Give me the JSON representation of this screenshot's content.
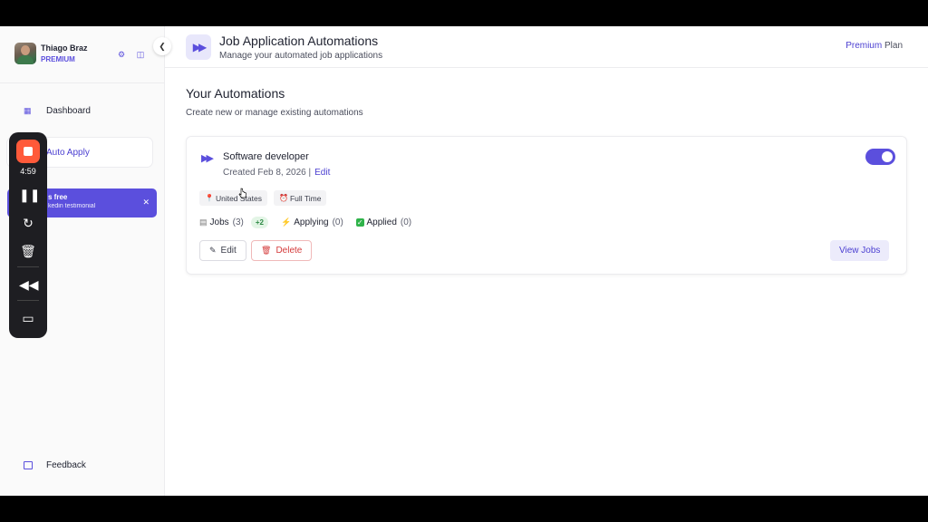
{
  "user": {
    "name": "Thiago Braz",
    "plan": "PREMIUM"
  },
  "sidebar": {
    "items": [
      {
        "label": "Dashboard",
        "icon": "grid-icon"
      },
      {
        "label": "Auto Apply",
        "icon": "fast-forward-icon"
      }
    ],
    "promo": {
      "title": "s free",
      "subtitle": "kedin testimonial"
    },
    "feedback_label": "Feedback"
  },
  "recorder": {
    "time": "4:59"
  },
  "header": {
    "title": "Job Application Automations",
    "subtitle": "Manage your automated job applications",
    "plan_name": "Premium",
    "plan_suffix": "Plan"
  },
  "main": {
    "title": "Your Automations",
    "subtitle": "Create new or manage existing automations"
  },
  "automation": {
    "title": "Software developer",
    "created": "Created Feb 8, 2026 |",
    "edit_link": "Edit",
    "enabled": true,
    "tags": [
      {
        "label": "United States",
        "icon": "pin-icon"
      },
      {
        "label": "Full Time",
        "icon": "alarm-icon"
      }
    ],
    "stats": {
      "jobs_label": "Jobs",
      "jobs_count": "(3)",
      "jobs_extra": "+2",
      "applying_label": "Applying",
      "applying_count": "(0)",
      "applied_label": "Applied",
      "applied_count": "(0)"
    },
    "buttons": {
      "edit": "Edit",
      "delete": "Delete",
      "view": "View Jobs"
    }
  },
  "colors": {
    "accent": "#5b4fdd",
    "danger": "#d43a3a",
    "success": "#2e8a45",
    "recorder_stop": "#ff5a3a"
  }
}
